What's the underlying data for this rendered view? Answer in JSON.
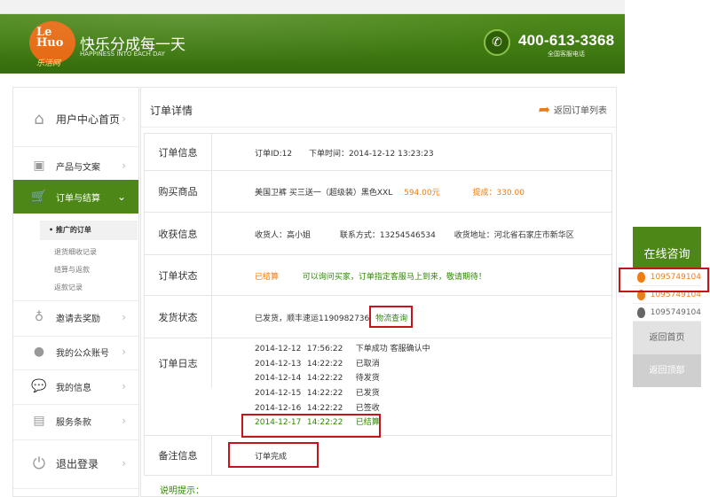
{
  "header": {
    "logo_line1": "Le",
    "logo_line2": "Huo",
    "logo_sub": "乐活网",
    "slogan": "快乐分成每一天",
    "slogan_en": "HAPPINESS INTO EACH DAY",
    "phone": "400-613-3368",
    "phone_sub": "全国客服电话",
    "icon": "phone-icon"
  },
  "sidebar": {
    "items": [
      {
        "label": "用户中心首页",
        "icon": "home-icon"
      },
      {
        "label": "产品与文案",
        "icon": "box-icon"
      },
      {
        "label": "订单与结算",
        "icon": "cart-icon"
      },
      {
        "label": "邀请去奖励",
        "icon": "award-icon"
      },
      {
        "label": "我的公众账号",
        "icon": "user-icon"
      },
      {
        "label": "我的信息",
        "icon": "chat-icon"
      },
      {
        "label": "服务条款",
        "icon": "document-icon"
      },
      {
        "label": "退出登录",
        "icon": "power-icon"
      }
    ],
    "sub_items": [
      "• 推广的订单",
      "退货细收记录",
      "结算与返款",
      "返款记录"
    ],
    "active_color": "#4d8717"
  },
  "main": {
    "title": "订单详情",
    "back_label": "返回订单列表",
    "rows": {
      "order_info": {
        "label": "订单信息",
        "order_id": "订单ID:12",
        "order_time": "下单时间：2014-12-12   13:23:23"
      },
      "goods": {
        "label": "购买商品",
        "name": "美国卫裤  买三送一（超级装）黑色XXL",
        "price": "594.00元",
        "commission": "提成：330.00"
      },
      "receiver": {
        "label": "收获信息",
        "name": "收货人：高小姐",
        "contact": "联系方式：13254546534",
        "address": "收货地址：河北省石家庄市新华区"
      },
      "status": {
        "label": "订单状态",
        "value": "已结算",
        "note": "可以询问买家，订单指定客服马上到来，敬请期待！"
      },
      "shipping": {
        "label": "发货状态",
        "value": "已发货，顺丰速运1190982736",
        "tracking_link": "物流查询"
      },
      "log": {
        "label": "订单日志",
        "entries": [
          {
            "date": "2014-12-12",
            "time": "17:56:22",
            "status": "下单成功  客服确认中"
          },
          {
            "date": "2014-12-13",
            "time": "14:22:22",
            "status": "已取消"
          },
          {
            "date": "2014-12-14",
            "time": "14:22:22",
            "status": "待发货"
          },
          {
            "date": "2014-12-15",
            "time": "14:22:22",
            "status": "已发货"
          },
          {
            "date": "2014-12-16",
            "time": "14:22:22",
            "status": "已签收"
          },
          {
            "date": "2014-12-17",
            "time": "14:22:22",
            "status": "已结算"
          }
        ]
      },
      "remark": {
        "label": "备注信息",
        "value": "订单完成"
      }
    },
    "hint": "说明提示：",
    "colors": {
      "orange": "#f07c14",
      "green": "#2e8a00",
      "highlight": "#c4141c"
    }
  },
  "float": {
    "title": "在线咨询",
    "qq": [
      "1095749104",
      "1095749104",
      "1095749104"
    ],
    "home_btn": "返回首页",
    "top_btn": "返回顶部"
  }
}
